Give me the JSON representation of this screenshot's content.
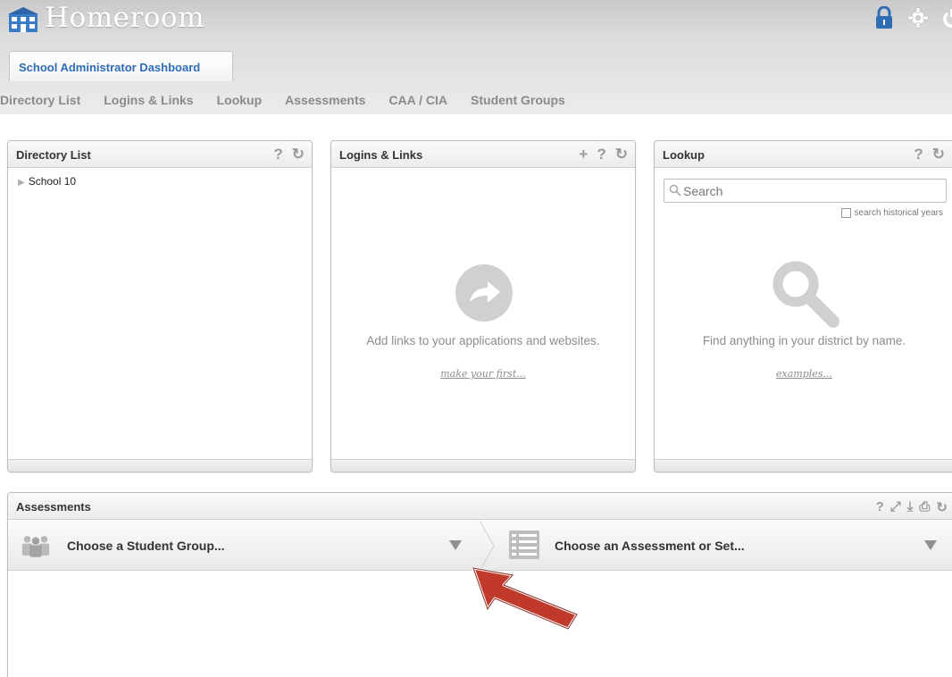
{
  "app": {
    "title": "Homeroom"
  },
  "tabs": {
    "active": "School Administrator Dashboard"
  },
  "nav": [
    "Directory List",
    "Logins & Links",
    "Lookup",
    "Assessments",
    "CAA / CIA",
    "Student Groups"
  ],
  "directory": {
    "title": "Directory List",
    "tools": [
      "?",
      "↻"
    ],
    "items": [
      "School 10"
    ]
  },
  "logins": {
    "title": "Logins & Links",
    "tools": [
      "+",
      "?",
      "↻"
    ],
    "empty_text": "Add links to your applications and websites.",
    "empty_link": "make your first..."
  },
  "lookup": {
    "title": "Lookup",
    "tools": [
      "?",
      "↻"
    ],
    "search_placeholder": "Search",
    "historical_label": "search historical years",
    "empty_text": "Find anything in your district by name.",
    "empty_link": "examples..."
  },
  "assessments": {
    "title": "Assessments",
    "student_group_label": "Choose a Student Group...",
    "assessment_label": "Choose an Assessment or Set..."
  },
  "icons": {
    "logo": "building-icon",
    "top": [
      "lock-icon",
      "gear-icon",
      "power-icon"
    ]
  },
  "colors": {
    "accent": "#2f6db5",
    "annotation_arrow": "#c0392b",
    "top_icon": "#2f6db5"
  }
}
